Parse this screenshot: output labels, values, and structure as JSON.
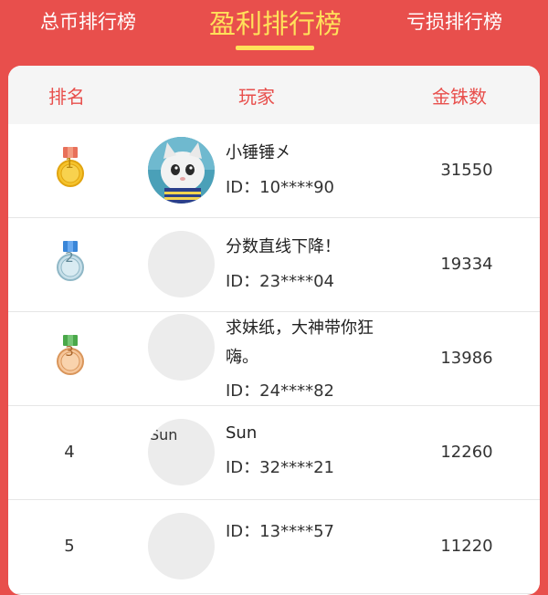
{
  "tabs": [
    {
      "label": "总币排行榜",
      "active": false
    },
    {
      "label": "盈利排行榜",
      "active": true
    },
    {
      "label": "亏损排行榜",
      "active": false
    }
  ],
  "colors": {
    "primary": "#e84f4c",
    "active_tab": "#ffe15a",
    "header_bg": "#f5f5f5"
  },
  "table": {
    "headers": {
      "rank": "排名",
      "player": "玩家",
      "coins": "金铢数"
    },
    "rows": [
      {
        "rank": "1",
        "medal": "gold-medal-icon",
        "name": "小锤锤㐅",
        "id": "ID：10****90",
        "coins": "31550",
        "avatar": "cat-photo"
      },
      {
        "rank": "2",
        "medal": "silver-medal-icon",
        "name": "分数直线下降！",
        "id": "ID：23****04",
        "coins": "19334",
        "avatar": "blank"
      },
      {
        "rank": "3",
        "medal": "bronze-medal-icon",
        "name": "求妹纸，大神带你狂嗨。",
        "id": "ID：24****82",
        "coins": "13986",
        "avatar": "blank"
      },
      {
        "rank": "4",
        "name": "Sun",
        "avatar_alt": "Sun",
        "id": "ID：32****21",
        "coins": "12260",
        "avatar": "blank"
      },
      {
        "rank": "5",
        "name": "",
        "id": "ID：13****57",
        "coins": "11220",
        "avatar": "blank"
      }
    ]
  }
}
